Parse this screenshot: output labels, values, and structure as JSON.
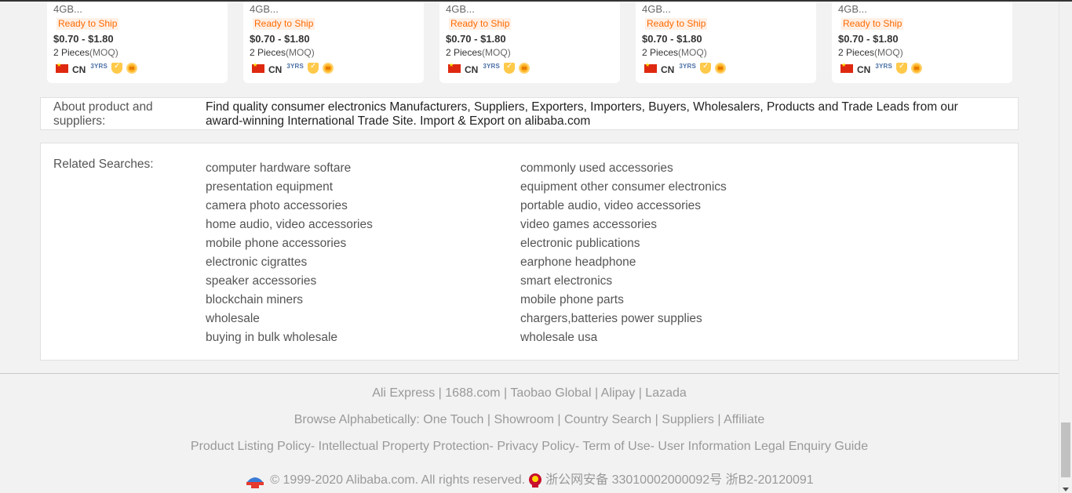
{
  "products": [
    {
      "name": "4GB...",
      "ship": "Ready to Ship",
      "price": "$0.70 - $1.80",
      "moq_qty": "2 Pieces",
      "moq_unit": "(MOQ)",
      "country": "CN",
      "years": "3YRS"
    },
    {
      "name": "4GB...",
      "ship": "Ready to Ship",
      "price": "$0.70 - $1.80",
      "moq_qty": "2 Pieces",
      "moq_unit": "(MOQ)",
      "country": "CN",
      "years": "3YRS"
    },
    {
      "name": "4GB...",
      "ship": "Ready to Ship",
      "price": "$0.70 - $1.80",
      "moq_qty": "2 Pieces",
      "moq_unit": "(MOQ)",
      "country": "CN",
      "years": "3YRS"
    },
    {
      "name": "4GB...",
      "ship": "Ready to Ship",
      "price": "$0.70 - $1.80",
      "moq_qty": "2 Pieces",
      "moq_unit": "(MOQ)",
      "country": "CN",
      "years": "3YRS"
    },
    {
      "name": "4GB...",
      "ship": "Ready to Ship",
      "price": "$0.70 - $1.80",
      "moq_qty": "2 Pieces",
      "moq_unit": "(MOQ)",
      "country": "CN",
      "years": "3YRS"
    }
  ],
  "about": {
    "label": "About product and suppliers:",
    "text": "Find quality consumer electronics Manufacturers, Suppliers, Exporters, Importers, Buyers, Wholesalers, Products and Trade Leads from our award-winning International Trade Site. Import & Export on alibaba.com"
  },
  "related": {
    "label": "Related Searches:",
    "col1": [
      "computer hardware softare",
      "presentation equipment",
      "camera photo accessories",
      "home audio, video accessories",
      "mobile phone accessories",
      "electronic cigrattes",
      "speaker accessories",
      "blockchain miners",
      "wholesale",
      "buying in bulk wholesale"
    ],
    "col2": [
      "commonly used accessories",
      "equipment other consumer electronics",
      "portable audio, video accessories",
      "video games accessories",
      "electronic publications",
      "earphone headphone",
      "smart electronics",
      "mobile phone parts",
      "chargers,batteries power supplies",
      "wholesale usa"
    ]
  },
  "footer": {
    "row1": [
      "Ali Express",
      "1688.com",
      "Taobao Global",
      "Alipay",
      "Lazada"
    ],
    "row2_prefix": "Browse Alphabetically:",
    "row2": [
      "One Touch",
      "Showroom",
      "Country Search",
      "Suppliers",
      "Affiliate"
    ],
    "row3": [
      "Product Listing Policy",
      "Intellectual Property Protection",
      "Privacy Policy",
      "Term of Use",
      "User Information Legal Enquiry Guide"
    ],
    "copyright": "© 1999-2020 Alibaba.com. All rights reserved.",
    "icp": "浙公网安备 33010002000092号 浙B2-20120091"
  },
  "colors": {
    "ready_to_ship": "#ff6a00",
    "link_gray": "#999999",
    "background": "#f2f2f2"
  }
}
